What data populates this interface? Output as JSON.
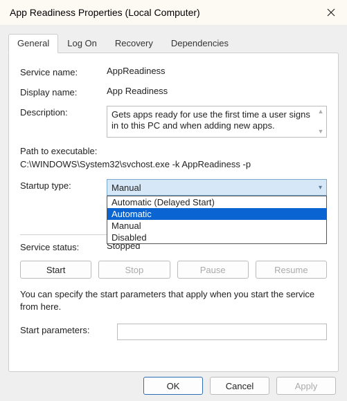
{
  "window": {
    "title": "App Readiness Properties (Local Computer)"
  },
  "tabs": {
    "items": [
      "General",
      "Log On",
      "Recovery",
      "Dependencies"
    ],
    "active": 0
  },
  "general": {
    "service_name_label": "Service name:",
    "service_name": "AppReadiness",
    "display_name_label": "Display name:",
    "display_name": "App Readiness",
    "description_label": "Description:",
    "description": "Gets apps ready for use the first time a user signs in to this PC and when adding new apps.",
    "path_label": "Path to executable:",
    "path": "C:\\WINDOWS\\System32\\svchost.exe -k AppReadiness -p",
    "startup_label": "Startup type:",
    "startup_selected": "Manual",
    "startup_options": [
      "Automatic (Delayed Start)",
      "Automatic",
      "Manual",
      "Disabled"
    ],
    "startup_highlighted": 1,
    "status_label": "Service status:",
    "status_value": "Stopped",
    "buttons": {
      "start": "Start",
      "stop": "Stop",
      "pause": "Pause",
      "resume": "Resume"
    },
    "note": "You can specify the start parameters that apply when you start the service from here.",
    "start_params_label": "Start parameters:",
    "start_params_value": ""
  },
  "footer": {
    "ok": "OK",
    "cancel": "Cancel",
    "apply": "Apply"
  }
}
